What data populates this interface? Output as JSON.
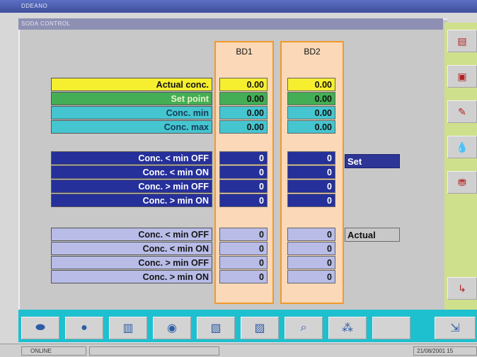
{
  "app": {
    "title": "DDEANO",
    "window_title": "SODA CONTROL"
  },
  "columns": [
    "BD1",
    "BD2"
  ],
  "rows_top": [
    {
      "label": "Actual conc.",
      "bd1": "0.00",
      "bd2": "0.00",
      "color": "#f6ef2f"
    },
    {
      "label": "Set point",
      "bd1": "0.00",
      "bd2": "0.00",
      "color": "#43ae55"
    },
    {
      "label": "Conc. min",
      "bd1": "0.00",
      "bd2": "0.00",
      "color": "#45c5cf"
    },
    {
      "label": "Conc. max",
      "bd1": "0.00",
      "bd2": "0.00",
      "color": "#45c5cf"
    }
  ],
  "rows_set": [
    {
      "label": "Conc. < min OFF",
      "bd1": "0",
      "bd2": "0"
    },
    {
      "label": "Conc. < min ON",
      "bd1": "0",
      "bd2": "0"
    },
    {
      "label": "Conc. > min OFF",
      "bd1": "0",
      "bd2": "0"
    },
    {
      "label": "Conc. > min ON",
      "bd1": "0",
      "bd2": "0"
    }
  ],
  "rows_actual": [
    {
      "label": "Conc. < min OFF",
      "bd1": "0",
      "bd2": "0"
    },
    {
      "label": "Conc. < min ON",
      "bd1": "0",
      "bd2": "0"
    },
    {
      "label": "Conc. > min OFF",
      "bd1": "0",
      "bd2": "0"
    },
    {
      "label": "Conc. > min ON",
      "bd1": "0",
      "bd2": "0"
    }
  ],
  "tags": {
    "set": "Set",
    "actual": "Actual"
  },
  "right_buttons": [
    "chart-icon",
    "window-icon",
    "pencil-icon",
    "drop-icon",
    "tank-icon",
    "exit-icon"
  ],
  "bottom_buttons": [
    "machine-icon",
    "traffic-light-icon",
    "chart-icon",
    "alarm-icon",
    "report-icon",
    "graph-icon",
    "search-icon",
    "dots-icon",
    "blank-icon",
    "exit-icon"
  ],
  "status": {
    "online": "ONLINE",
    "datetime": "21/08/2001 15"
  },
  "colors": {
    "accent_border": "#f09a2c",
    "column_bg": "#fad8b8",
    "set_bg": "#26309b",
    "actual_bg": "#b8bce7",
    "bottom_bar": "#1ec0cf",
    "right_bar": "#cfe08c"
  }
}
